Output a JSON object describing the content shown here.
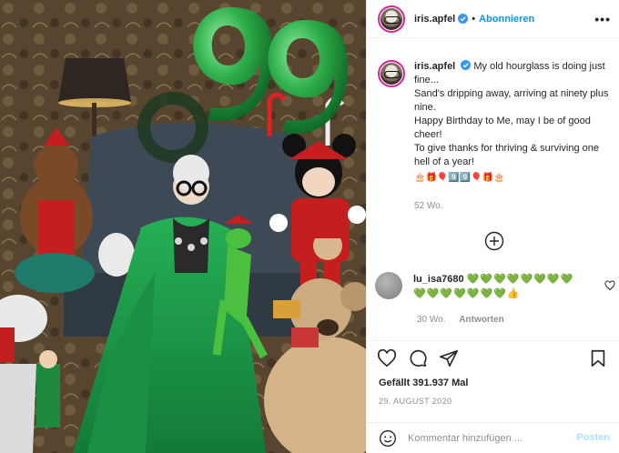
{
  "post": {
    "username": "iris.apfel",
    "follow_label": "Abonnieren",
    "more_icon": "more-horizontal-icon",
    "caption": {
      "lines": [
        "My old hourglass is doing just fine...",
        "Sand's dripping away, arriving at ninety plus nine.",
        "Happy Birthday to Me, may I be of good cheer!",
        "To give thanks for thriving & surviving one hell of a year!"
      ],
      "emojis": "🎂🎁🎈9️⃣9️⃣🎈🎁🎂",
      "age": "52 Wo."
    },
    "comment": {
      "username": "lu_isa7680",
      "text": "💚💚💚💚💚💚💚💚💚💚💚💚💚💚💚👍",
      "age": "30 Wo.",
      "reply_label": "Antworten"
    },
    "likes": "Gefällt 391.937 Mal",
    "date": "29. August 2020",
    "comment_placeholder": "Kommentar hinzufügen ...",
    "post_label": "Posten"
  },
  "colors": {
    "accent": "#0095f6",
    "balloon_green": "#2fb24c",
    "dress_green": "#1f9a4a"
  }
}
